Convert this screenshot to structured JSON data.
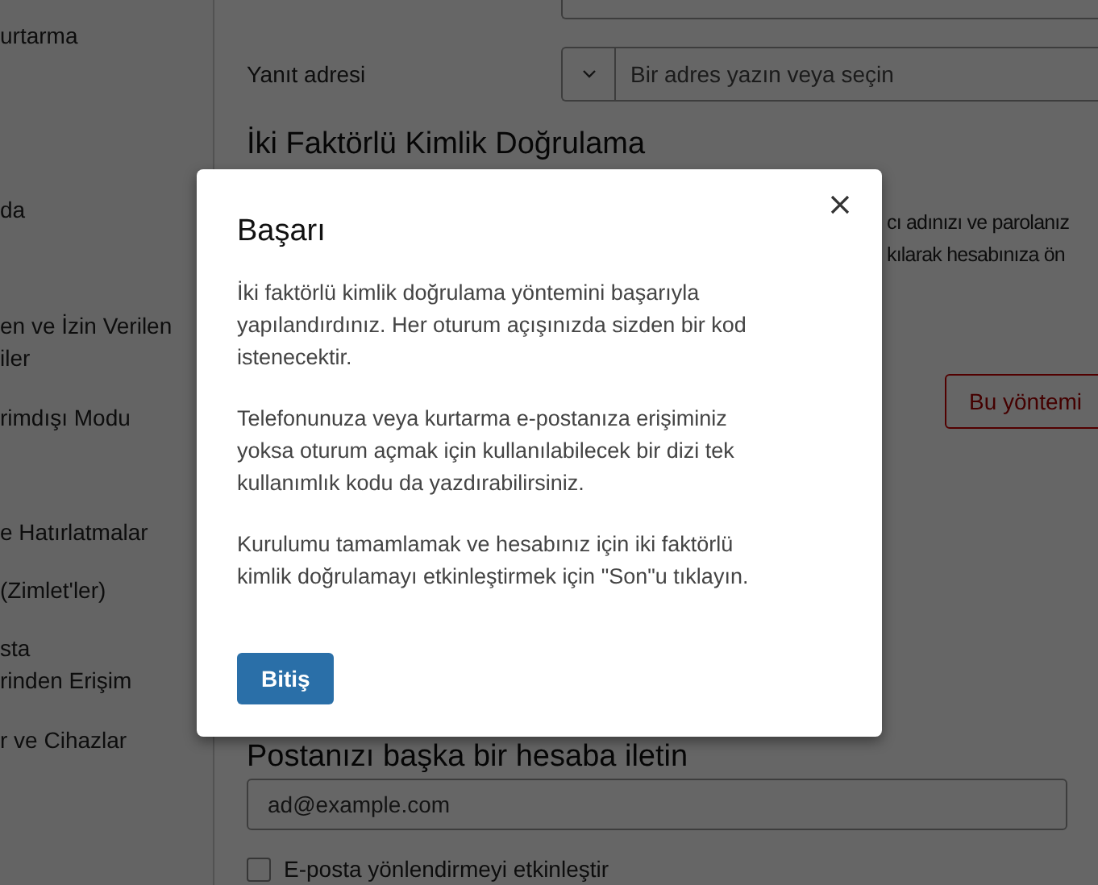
{
  "sidebar": {
    "items": [
      {
        "label": "urtarma"
      },
      {
        "label": "da"
      },
      {
        "label": "en ve İzin Verilen\niler"
      },
      {
        "label": "rimdışı Modu"
      },
      {
        "label": "e Hatırlatmalar"
      },
      {
        "label": "(Zimlet'ler)"
      },
      {
        "label": "sta\nrinden Erişim"
      },
      {
        "label": "r ve Cihazlar"
      }
    ]
  },
  "reply_address": {
    "label": "Yanıt adresi",
    "placeholder": "Bir adres yazın veya seçin"
  },
  "two_factor": {
    "heading": "İki Faktörlü Kimlik Doğrulama",
    "text_lines": [
      "cı adınızı ve parolanız",
      "kılarak hesabınıza ön"
    ],
    "button": "Bu yöntemi"
  },
  "forwarding": {
    "heading": "Postanızı başka bir hesaba iletin",
    "placeholder": "ad@example.com",
    "checkbox": {
      "label": "E-posta yönlendirmeyi etkinleştir",
      "checked": false
    }
  },
  "dialog": {
    "title": "Başarı",
    "paragraphs": [
      "İki faktörlü kimlik doğrulama yöntemini başarıyla yapılandırdınız. Her oturum açışınızda sizden bir kod istenecektir.",
      "Telefonunuza veya kurtarma e-postanıza erişiminiz yoksa oturum açmak için kullanılabilecek bir dizi tek kullanımlık kodu da yazdırabilirsiniz.",
      "Kurulumu tamamlamak ve hesabınız için iki faktörlü kimlik doğrulamayı etkinleştirmek için \"Son\"u tıklayın."
    ],
    "button": "Bitiş"
  }
}
